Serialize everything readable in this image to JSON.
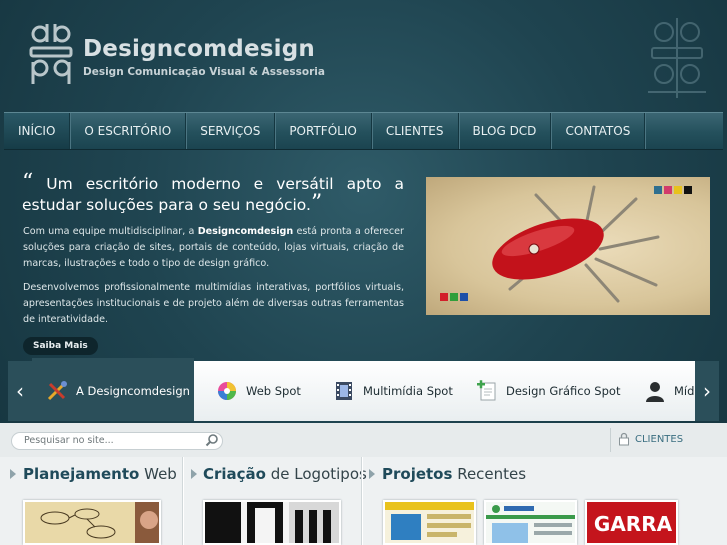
{
  "header": {
    "brand": "Designcomdesign",
    "tagline": "Design Comunicação Visual & Assessoria"
  },
  "nav": {
    "items": [
      {
        "label": "INÍCIO",
        "active": true
      },
      {
        "label": "O ESCRITÓRIO"
      },
      {
        "label": "SERVIÇOS"
      },
      {
        "label": "PORTFÓLIO"
      },
      {
        "label": "CLIENTES"
      },
      {
        "label": "BLOG DCD"
      },
      {
        "label": "CONTATOS"
      }
    ]
  },
  "hero": {
    "quote": "Um escritório moderno e versátil apto a estudar soluções para o seu negócio.",
    "paragraph1_pre": "Com uma equipe multidisciplinar, a ",
    "paragraph1_brand": "Designcomdesign",
    "paragraph1_post": " está pronta a oferecer soluções para criação de sites, portais de conteúdo, lojas virtuais, criação de marcas, ilustrações e todo o tipo de design gráfico.",
    "paragraph2": "Desenvolvemos profissionalmente multimídias interativas, portfólios virtuais, apresentações institucionais e de projeto além de diversas outras ferramentas de interatividade.",
    "more_button": "Saiba Mais",
    "image_swatches": [
      "#2f6f8f",
      "#d23b6b",
      "#e8c21d",
      "#111111"
    ],
    "image_swatches_bottom": [
      "#d21f2a",
      "#2f9e3a",
      "#1d4fa8"
    ]
  },
  "spots": {
    "items": [
      {
        "label": "A Designcomdesign",
        "icon": "tools-icon",
        "active": true
      },
      {
        "label": "Web Spot",
        "icon": "color-wheel-icon"
      },
      {
        "label": "Multimídia Spot",
        "icon": "film-icon"
      },
      {
        "label": "Design Gráfico Spot",
        "icon": "document-add-icon"
      },
      {
        "label": "Mídi",
        "icon": "person-icon"
      }
    ],
    "prev": "‹",
    "next": "›"
  },
  "search": {
    "placeholder": "Pesquisar no site..."
  },
  "clients_link": "CLIENTES",
  "columns": [
    {
      "bold": "Planejamento",
      "rest": " Web"
    },
    {
      "bold": "Criação",
      "rest": " de Logotipos"
    },
    {
      "bold": "Projetos",
      "rest": " Recentes"
    }
  ],
  "thumbs": {
    "garra_text": "GARRA"
  }
}
